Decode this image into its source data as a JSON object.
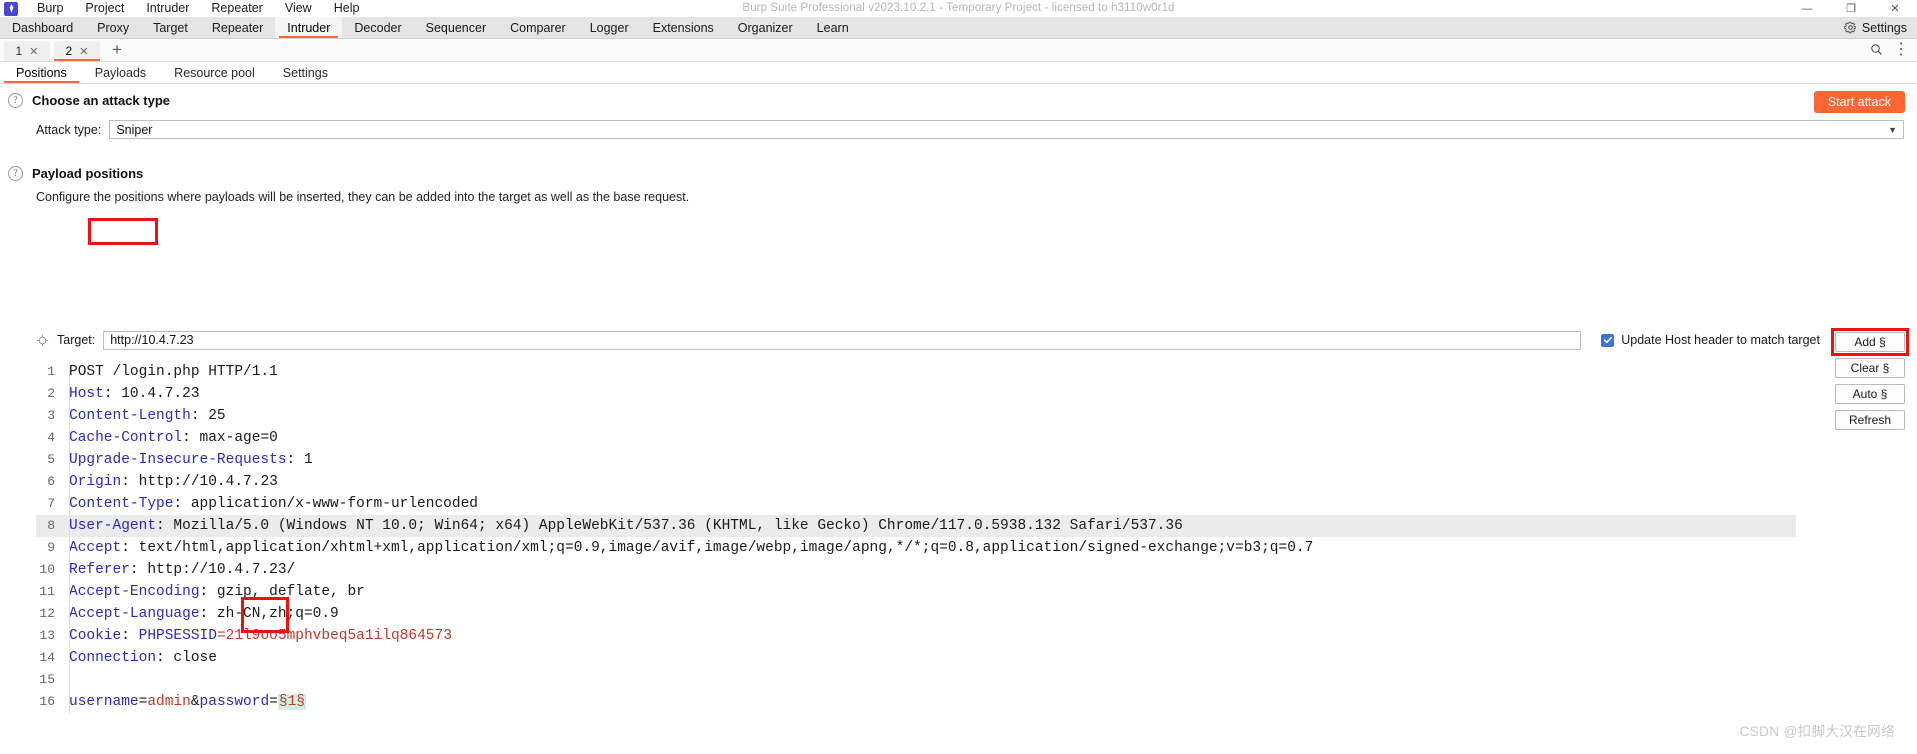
{
  "window": {
    "title": "Burp Suite Professional v2023.10.2.1 - Temporary Project - licensed to h3110w0r1d",
    "logo_glyph": "♦",
    "minimize": "—",
    "maximize": "❐",
    "close": "✕"
  },
  "menu": {
    "items": [
      {
        "label": "Burp"
      },
      {
        "label": "Project"
      },
      {
        "label": "Intruder"
      },
      {
        "label": "Repeater"
      },
      {
        "label": "View"
      },
      {
        "label": "Help"
      }
    ]
  },
  "nav": {
    "tabs": [
      {
        "label": "Dashboard",
        "active": false
      },
      {
        "label": "Proxy",
        "active": false
      },
      {
        "label": "Target",
        "active": false
      },
      {
        "label": "Repeater",
        "active": false
      },
      {
        "label": "Intruder",
        "active": true
      },
      {
        "label": "Decoder",
        "active": false
      },
      {
        "label": "Sequencer",
        "active": false
      },
      {
        "label": "Comparer",
        "active": false
      },
      {
        "label": "Logger",
        "active": false
      },
      {
        "label": "Extensions",
        "active": false
      },
      {
        "label": "Organizer",
        "active": false
      },
      {
        "label": "Learn",
        "active": false
      }
    ],
    "settings_label": "Settings"
  },
  "attack_tabs": {
    "tabs": [
      {
        "label": "1",
        "close": "✕",
        "active": false
      },
      {
        "label": "2",
        "close": "✕",
        "active": true
      }
    ],
    "add_label": "+",
    "search_glyph": "⌕",
    "menu_glyph": "⋮"
  },
  "sub_tabs": [
    {
      "label": "Positions",
      "active": true
    },
    {
      "label": "Payloads",
      "active": false
    },
    {
      "label": "Resource pool",
      "active": false
    },
    {
      "label": "Settings",
      "active": false
    }
  ],
  "attack_type_section": {
    "help": "?",
    "title": "Choose an attack type",
    "label": "Attack type:",
    "value": "Sniper",
    "caret": "▼",
    "start_attack": "Start attack"
  },
  "payload_positions_section": {
    "help": "?",
    "title": "Payload positions",
    "description": "Configure the positions where payloads will be inserted, they can be added into the target as well as the base request."
  },
  "target": {
    "label": "Target:",
    "value": "http://10.4.7.23",
    "update_host_label": "Update Host header to match target",
    "update_host_checked": true
  },
  "side_buttons": [
    {
      "label": "Add §",
      "highlighted": true
    },
    {
      "label": "Clear §",
      "highlighted": false
    },
    {
      "label": "Auto §",
      "highlighted": false
    },
    {
      "label": "Refresh",
      "highlighted": false
    }
  ],
  "request": {
    "lines": [
      {
        "n": 1,
        "segments": [
          {
            "t": "POST /login.php HTTP/1.1",
            "c": "v"
          }
        ]
      },
      {
        "n": 2,
        "segments": [
          {
            "t": "Host",
            "c": "k"
          },
          {
            "t": ": 10.4.7.23",
            "c": "v"
          }
        ]
      },
      {
        "n": 3,
        "segments": [
          {
            "t": "Content-Length",
            "c": "k"
          },
          {
            "t": ": 25",
            "c": "v"
          }
        ]
      },
      {
        "n": 4,
        "segments": [
          {
            "t": "Cache-Control",
            "c": "k"
          },
          {
            "t": ": max-age=0",
            "c": "v"
          }
        ]
      },
      {
        "n": 5,
        "segments": [
          {
            "t": "Upgrade-Insecure-Requests",
            "c": "k"
          },
          {
            "t": ": 1",
            "c": "v"
          }
        ]
      },
      {
        "n": 6,
        "segments": [
          {
            "t": "Origin",
            "c": "k"
          },
          {
            "t": ": http://10.4.7.23",
            "c": "v"
          }
        ]
      },
      {
        "n": 7,
        "segments": [
          {
            "t": "Content-Type",
            "c": "k"
          },
          {
            "t": ": application/x-www-form-urlencoded",
            "c": "v"
          }
        ]
      },
      {
        "n": 8,
        "highlight": true,
        "segments": [
          {
            "t": "User-Agent",
            "c": "k"
          },
          {
            "t": ": Mozilla/5.0 (Windows NT 10.0; Win64; x64) AppleWebKit/537.36 (KHTML, like Gecko) Chrome/117.0.5938.132 Safari/537.36",
            "c": "v"
          }
        ]
      },
      {
        "n": 9,
        "segments": [
          {
            "t": "Accept",
            "c": "k"
          },
          {
            "t": ": text/html,application/xhtml+xml,application/xml;q=0.9,image/avif,image/webp,image/apng,*/*;q=0.8,application/signed-exchange;v=b3;q=0.7",
            "c": "v"
          }
        ]
      },
      {
        "n": 10,
        "segments": [
          {
            "t": "Referer",
            "c": "k"
          },
          {
            "t": ": http://10.4.7.23/",
            "c": "v"
          }
        ]
      },
      {
        "n": 11,
        "segments": [
          {
            "t": "Accept-Encoding",
            "c": "k"
          },
          {
            "t": ": gzip, deflate, br",
            "c": "v"
          }
        ]
      },
      {
        "n": 12,
        "segments": [
          {
            "t": "Accept-Language",
            "c": "k"
          },
          {
            "t": ": zh-CN,zh;q=0.9",
            "c": "v"
          }
        ]
      },
      {
        "n": 13,
        "segments": [
          {
            "t": "Cookie",
            "c": "k"
          },
          {
            "t": ": ",
            "c": "v"
          },
          {
            "t": "PHPSESSID",
            "c": "k"
          },
          {
            "t": "=21l9oo5mphvbeq5a1ilq864573",
            "c": "r"
          }
        ]
      },
      {
        "n": 14,
        "segments": [
          {
            "t": "Connection",
            "c": "k"
          },
          {
            "t": ": close",
            "c": "v"
          }
        ]
      },
      {
        "n": 15,
        "segments": [
          {
            "t": "",
            "c": "v"
          }
        ]
      },
      {
        "n": 16,
        "segments": [
          {
            "t": "username",
            "c": "k"
          },
          {
            "t": "=",
            "c": "v"
          },
          {
            "t": "admin",
            "c": "r"
          },
          {
            "t": "&",
            "c": "v"
          },
          {
            "t": "password",
            "c": "k"
          },
          {
            "t": "=",
            "c": "v"
          },
          {
            "t": "§1§",
            "c": "payload"
          }
        ]
      }
    ]
  },
  "watermark": "CSDN @扣脚大汉在网络",
  "colors": {
    "accent": "#ff6633",
    "highlight_box": "#ee1111",
    "header_blue": "#2b2bbd",
    "value_red": "#c0392b",
    "payload_bg": "#cfeee3"
  }
}
